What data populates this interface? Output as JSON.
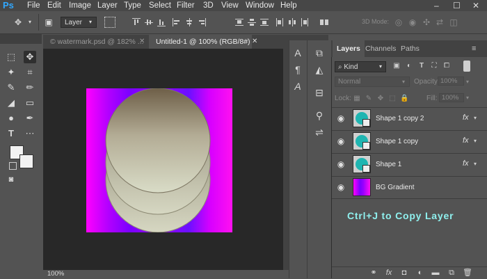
{
  "app": {
    "logo": "Ps"
  },
  "menu": [
    "File",
    "Edit",
    "Image",
    "Layer",
    "Type",
    "Select",
    "Filter",
    "3D",
    "View",
    "Window",
    "Help"
  ],
  "window_controls": {
    "minimize": "–",
    "restore": "☐",
    "close": "✕"
  },
  "options_bar": {
    "auto_select_target": "Layer",
    "mode_3d_label": "3D Mode:"
  },
  "tabs": [
    {
      "label": "© watermark.psd @ 182% ...",
      "active": false,
      "close": "✕"
    },
    {
      "label": "Untitled-1 @ 100% (RGB/8#) *",
      "active": true,
      "close": "✕"
    }
  ],
  "status": {
    "zoom": "100%"
  },
  "panel": {
    "tabs": [
      "Layers",
      "Channels",
      "Paths"
    ],
    "active_tab": "Layers",
    "filter_kind": "Kind",
    "blend_mode": "Normal",
    "opacity_label": "Opacity:",
    "opacity_value": "100%",
    "lock_label": "Lock:",
    "fill_label": "Fill:",
    "fill_value": "100%"
  },
  "layers": [
    {
      "name": "Shape 1 copy 2",
      "type": "shape",
      "fx": "fx",
      "visible": true
    },
    {
      "name": "Shape 1 copy",
      "type": "shape",
      "fx": "fx",
      "visible": true
    },
    {
      "name": "Shape 1",
      "type": "shape",
      "fx": "fx",
      "visible": true
    },
    {
      "name": "BG Gradient",
      "type": "gradient",
      "fx": "",
      "visible": true
    }
  ],
  "hint": "Ctrl+J to Copy Layer",
  "colors": {
    "canvas_magenta": "#ff00ff",
    "canvas_violet": "#7a00ff",
    "shape_teal": "#1fb5b1",
    "hint_text": "#8ff0ee",
    "ps_blue": "#31a8ff"
  },
  "icons": {
    "move": "✥",
    "marquee": "⬚",
    "lasso": "ʃ",
    "wand": "✦",
    "crop": "⌗",
    "eyedropper": "✎",
    "brush": "✏",
    "eraser": "◢",
    "gradient": "▭",
    "pen": "✒",
    "type": "T",
    "ellipsis": "⋯",
    "eye": "👁",
    "link": "🔗"
  }
}
